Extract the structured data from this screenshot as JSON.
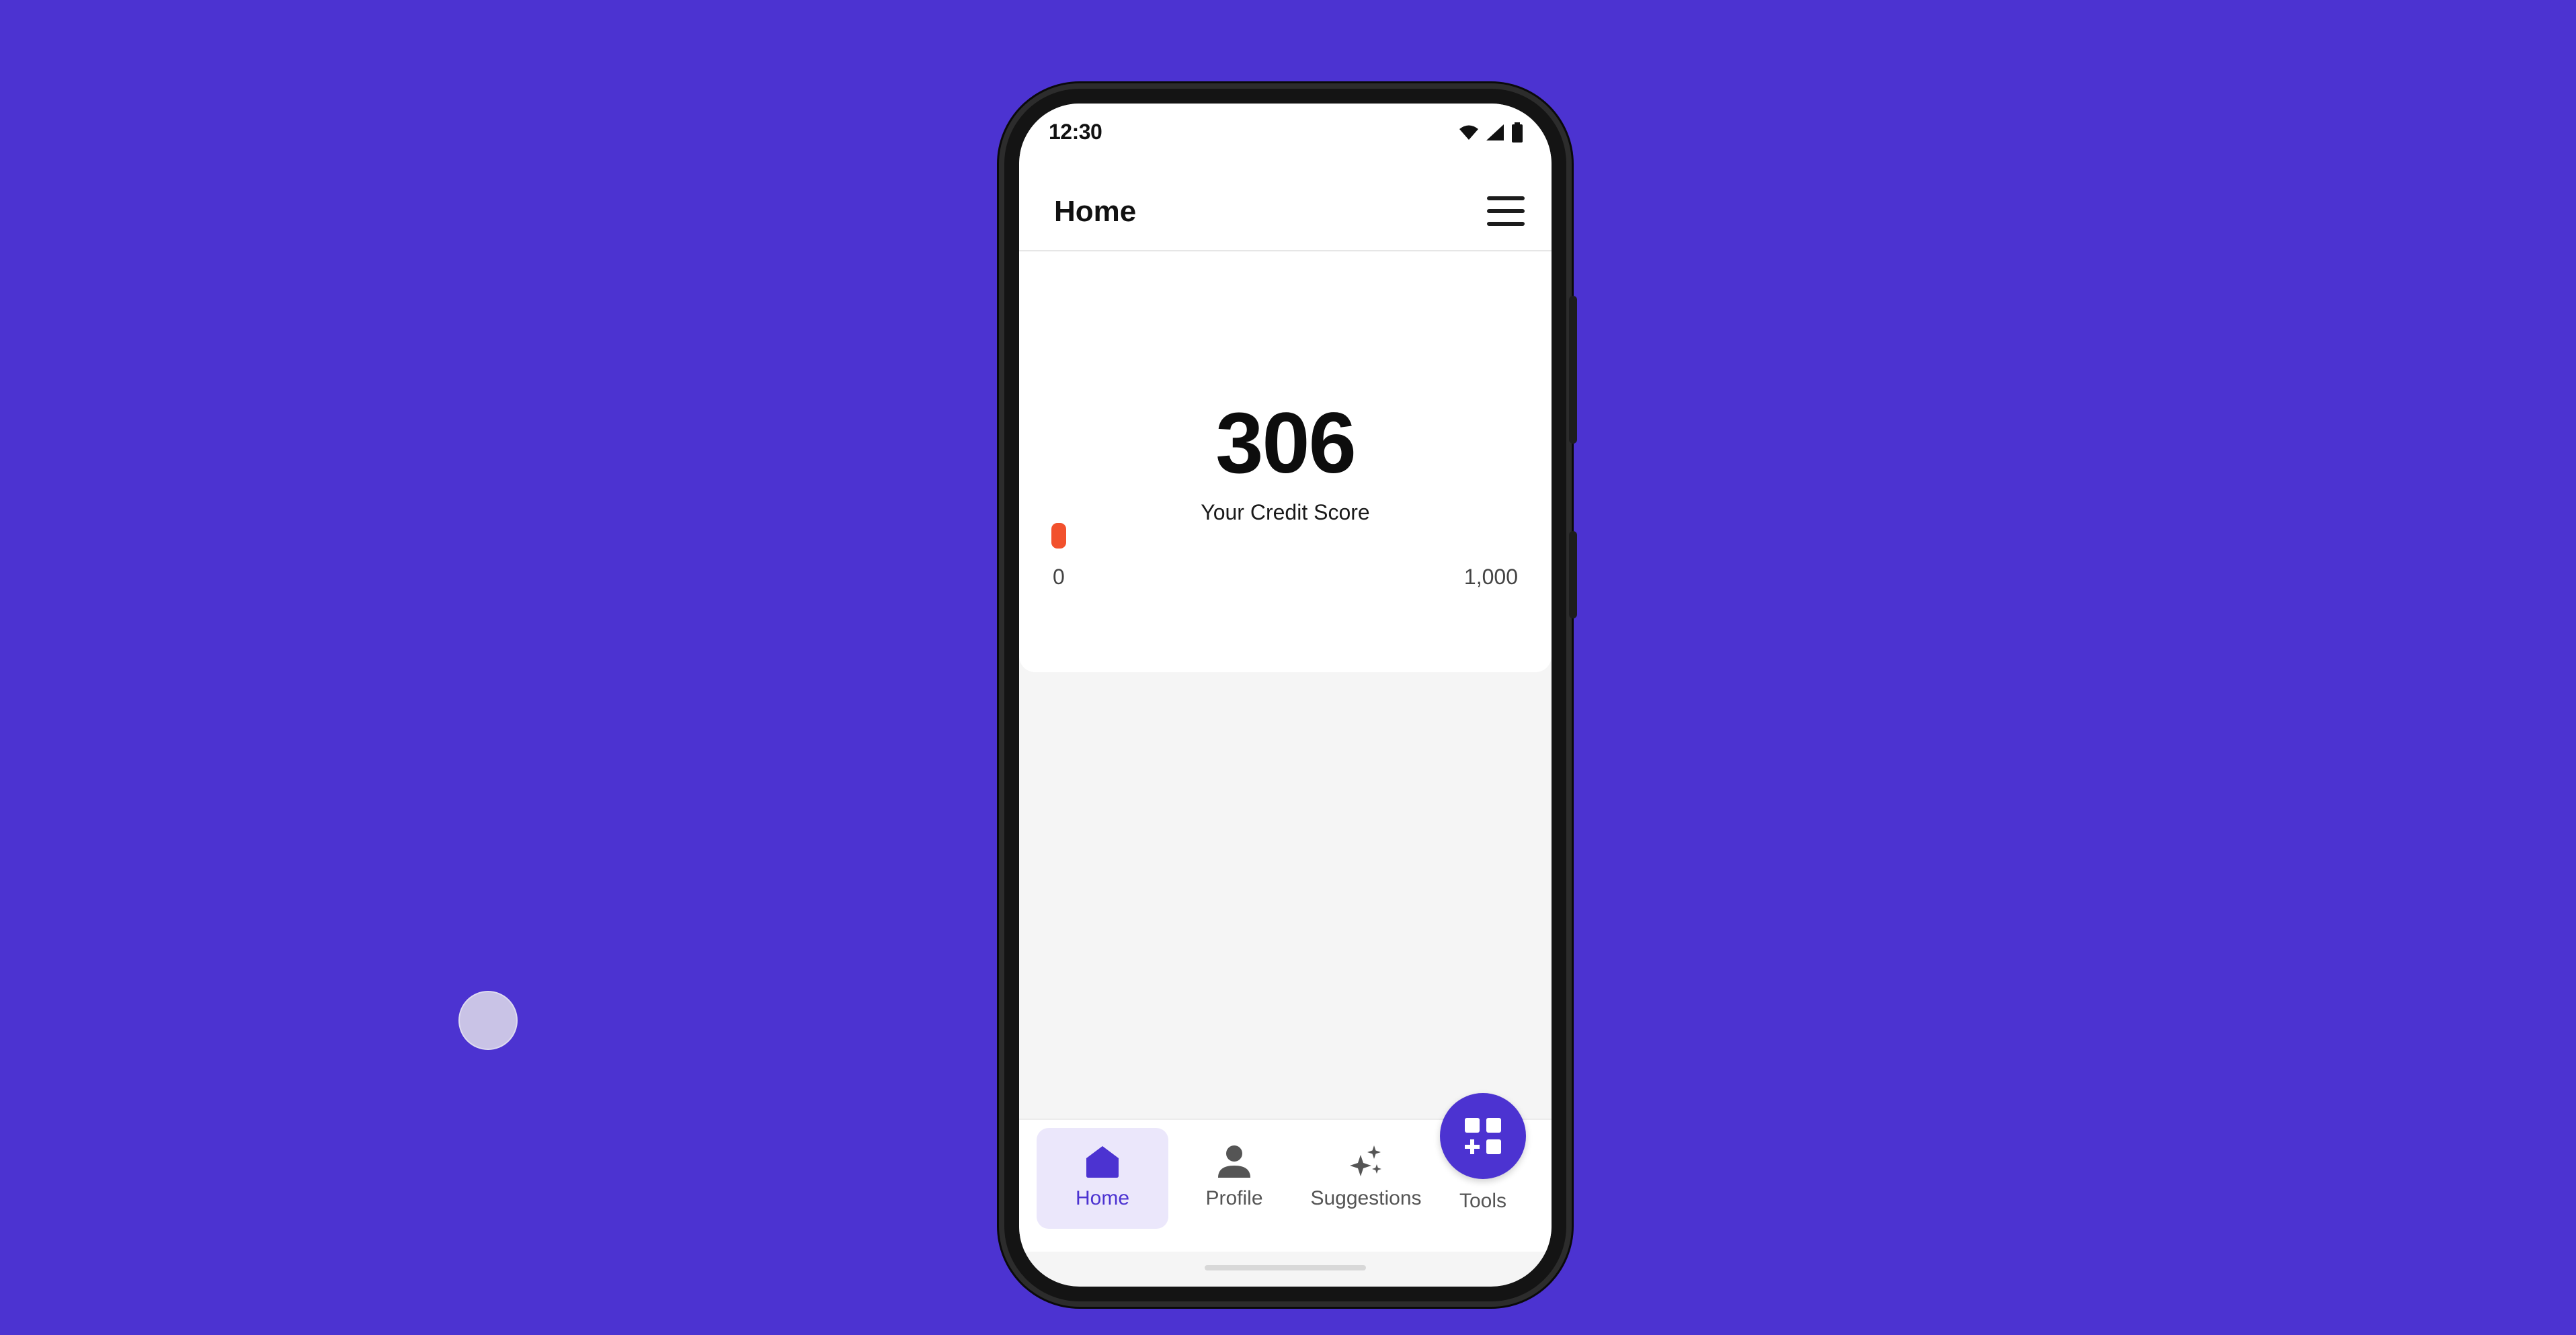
{
  "status_bar": {
    "time": "12:30",
    "icons": [
      "wifi-icon",
      "signal-icon",
      "battery-icon"
    ]
  },
  "app_bar": {
    "title": "Home",
    "menu_icon": "hamburger-menu-icon"
  },
  "credit_score": {
    "value": "306",
    "label": "Your Credit Score",
    "range_min": "0",
    "range_max": "1,000",
    "marker_color": "#f2512d"
  },
  "bottom_nav": {
    "items": [
      {
        "label": "Home",
        "icon": "home-icon",
        "active": true
      },
      {
        "label": "Profile",
        "icon": "person-icon",
        "active": false
      },
      {
        "label": "Suggestions",
        "icon": "sparkle-icon",
        "active": false
      },
      {
        "label": "Tools",
        "icon": "tools-grid-icon",
        "active": false
      }
    ]
  },
  "colors": {
    "background": "#4c33d1",
    "accent": "#4c33d1",
    "nav_active_bg": "#ebe7fb"
  }
}
